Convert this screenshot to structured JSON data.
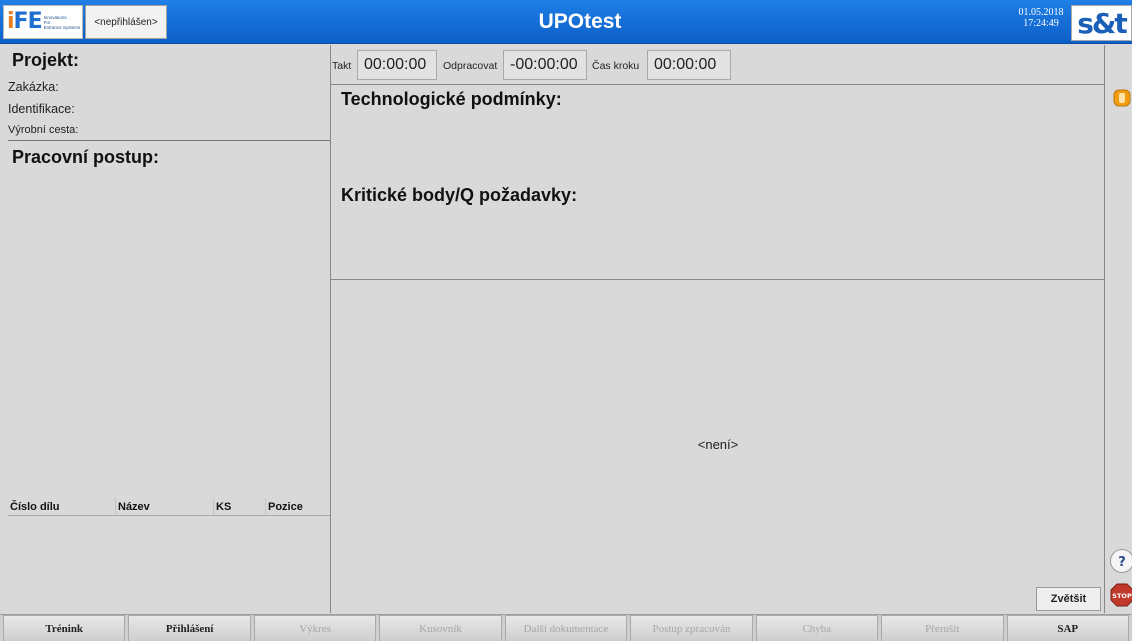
{
  "header": {
    "app_title": "UPOtest",
    "user_status": "<nepřihlášen>",
    "date": "01.05.2018",
    "time": "17:24:49",
    "ife_logo": {
      "mark": "iFE",
      "tagline": [
        "Innovations",
        "For",
        "Entrance Systems"
      ],
      "accent": "#e67e22",
      "brand": "#1f6fd0"
    },
    "snt_logo": {
      "mark": "s&t",
      "color": "#1a5fb8"
    },
    "bar_color": "#0c5fc8"
  },
  "project": {
    "title": "Projekt:",
    "rows": [
      {
        "label": "Zakázka:"
      },
      {
        "label": "Identifikace:"
      },
      {
        "label": "Výrobní cesta:"
      }
    ]
  },
  "procedure": {
    "title": "Pracovní postup:"
  },
  "parts_table": {
    "columns": [
      "Číslo dílu",
      "Název",
      "KS",
      "Pozice"
    ],
    "rows": []
  },
  "timers": {
    "takt_label": "Takt",
    "takt_value": "00:00:00",
    "odpracovat_label": "Odpracovat",
    "odpracovat_value": "-00:00:00",
    "cas_kroku_label": "Čas kroku",
    "cas_kroku_value": "00:00:00"
  },
  "conditions": {
    "tech_title": "Technologické podmínky:",
    "krit_title": "Kritické body/Q požadavky:"
  },
  "document_area": {
    "placeholder": "<není>",
    "enlarge_label": "Zvětšit"
  },
  "side_icons": [
    "bell-icon",
    "help-icon",
    "stop-icon"
  ],
  "toolbar": {
    "buttons": [
      {
        "label": "Trénink",
        "enabled": true
      },
      {
        "label": "Přihlášení",
        "enabled": true
      },
      {
        "label": "Výkres",
        "enabled": false
      },
      {
        "label": "Kusovník",
        "enabled": false
      },
      {
        "label": "Další dokumentace",
        "enabled": false
      },
      {
        "label": "Postup zpracován",
        "enabled": false
      },
      {
        "label": "Chyba",
        "enabled": false
      },
      {
        "label": "Přerušit",
        "enabled": false
      },
      {
        "label": "SAP",
        "enabled": true
      }
    ]
  }
}
